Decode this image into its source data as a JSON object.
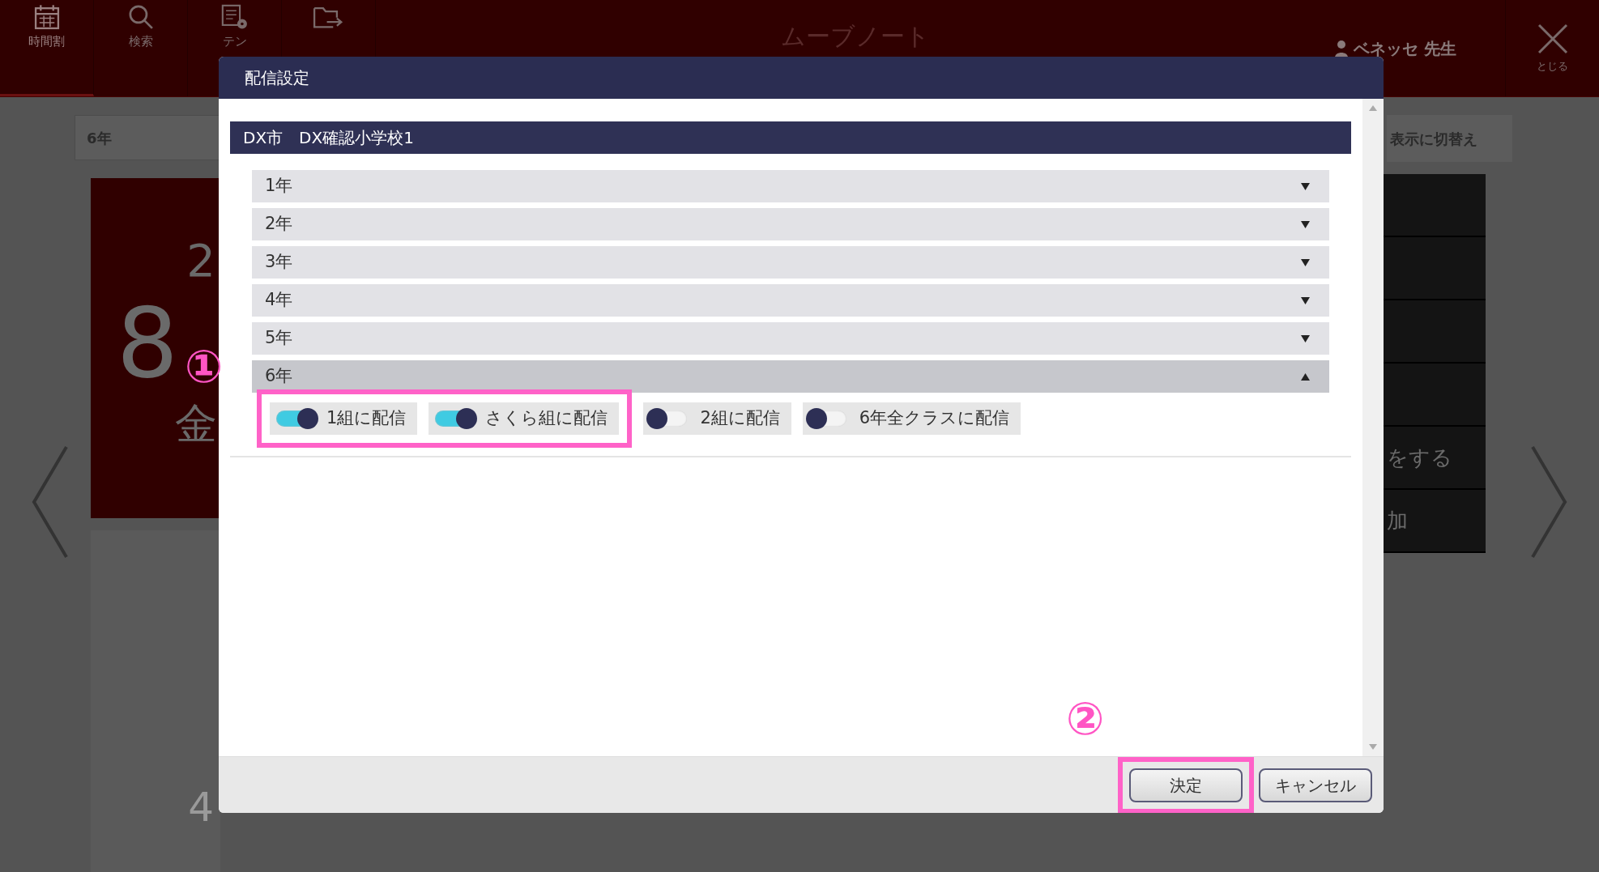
{
  "app": {
    "nav": [
      {
        "label": "時間割",
        "kind": "calendar",
        "selected": true
      },
      {
        "label": "検索",
        "kind": "search",
        "selected": false
      },
      {
        "label": "テン",
        "kind": "document",
        "selected": false
      },
      {
        "kind": "folder",
        "selected": false
      }
    ],
    "title": "ムーブノート",
    "user": "ベネッセ 先生",
    "close_label": "とじる",
    "grade_select": "6年",
    "switch_button": "表示に切替え",
    "day_card": {
      "line_1": "2",
      "big": "8",
      "line_3": "金"
    },
    "menu_items": [
      "をする",
      "加"
    ],
    "lower_card": "4"
  },
  "dialog": {
    "title": "配信設定",
    "school": "DX市　DX確認小学校1",
    "grades": [
      {
        "label": "1年",
        "expanded": false
      },
      {
        "label": "2年",
        "expanded": false
      },
      {
        "label": "3年",
        "expanded": false
      },
      {
        "label": "4年",
        "expanded": false
      },
      {
        "label": "5年",
        "expanded": false
      },
      {
        "label": "6年",
        "expanded": true,
        "options": [
          {
            "label": "1組に配信",
            "on": true,
            "highlighted": true
          },
          {
            "label": "さくら組に配信",
            "on": true,
            "highlighted": true
          },
          {
            "label": "2組に配信",
            "on": false,
            "highlighted": false
          },
          {
            "label": "6年全クラスに配信",
            "on": false,
            "highlighted": false
          }
        ]
      }
    ],
    "buttons": [
      {
        "label": "決定",
        "highlighted": true
      },
      {
        "label": "キャンセル",
        "highlighted": false
      }
    ]
  },
  "annotations": [
    {
      "label": "①",
      "kind": "toggles"
    },
    {
      "label": "②",
      "kind": "buttons"
    }
  ]
}
